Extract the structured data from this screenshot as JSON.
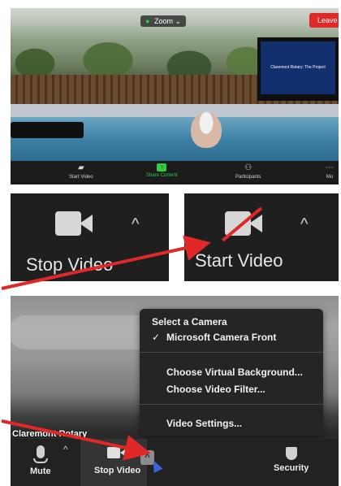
{
  "meeting": {
    "zoom_label": "Zoom",
    "leave_label": "Leave",
    "thumbnail_text": "Claremont Rotary: The Project",
    "toolbar": [
      {
        "label": "Start Video",
        "icon": "video-off-icon"
      },
      {
        "label": "Share Content",
        "icon": "share-screen-icon"
      },
      {
        "label": "Participants",
        "icon": "participants-icon"
      },
      {
        "label": "Mo",
        "icon": "more-icon"
      }
    ]
  },
  "stop_panel": {
    "label": "Stop Video",
    "caret": "^"
  },
  "start_panel": {
    "label": "Start Video",
    "caret": "^"
  },
  "camera_menu": {
    "header": "Select a Camera",
    "selected_camera": "Microsoft Camera Front",
    "check": "✓",
    "items": [
      "Choose Virtual Background...",
      "Choose Video Filter...",
      "Video Settings..."
    ]
  },
  "bottom_bar": {
    "caption": "Claremont Rotary",
    "mute_label": "Mute",
    "stop_video_label": "Stop Video",
    "security_label": "Security",
    "caret": "^"
  },
  "colors": {
    "accent_red": "#e02828",
    "zoom_green": "#2ecc40",
    "panel_bg": "#1f1f1f",
    "cursor_blue": "#3b64d8"
  }
}
